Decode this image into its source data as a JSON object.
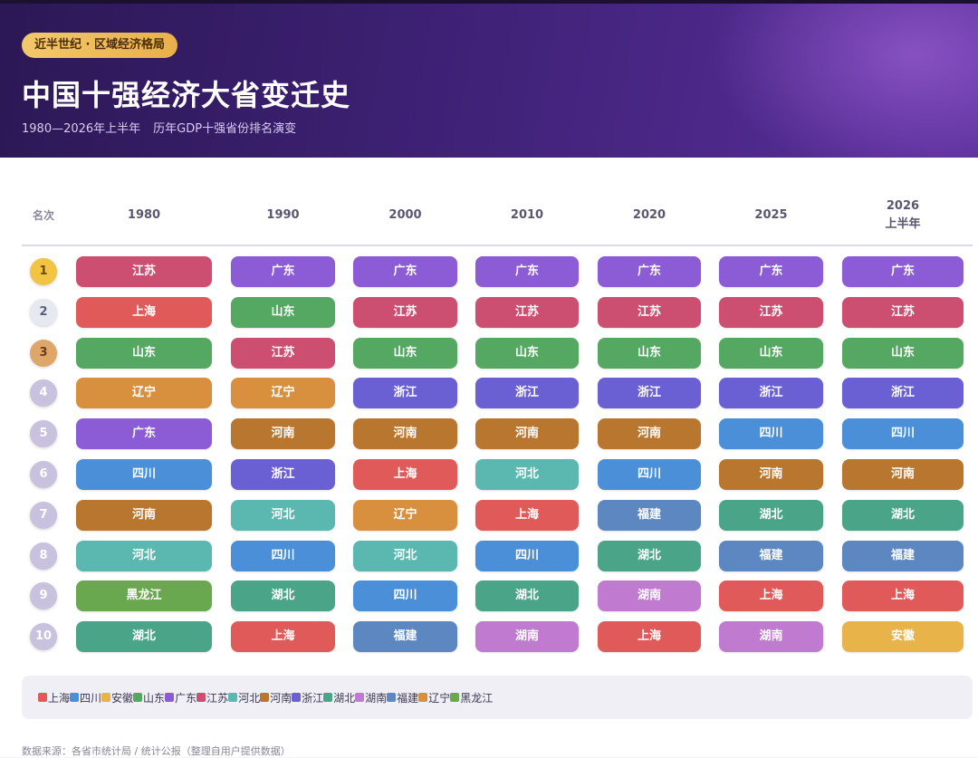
{
  "header": {
    "badge": "近半世纪 · 区域经济格局",
    "title": "中国十强经济大省变迁史",
    "subtitle_range": "1980—2026年上半年",
    "subtitle_desc": "历年GDP十强省份排名演变"
  },
  "table": {
    "rank_header": "名次",
    "columns": [
      {
        "label": "1980"
      },
      {
        "label": "1990"
      },
      {
        "label": "2000"
      },
      {
        "label": "2010"
      },
      {
        "label": "2020"
      },
      {
        "label": "2025"
      },
      {
        "label": "2026\n上半年"
      }
    ],
    "ranks": [
      "1",
      "2",
      "3",
      "4",
      "5",
      "6",
      "7",
      "8",
      "9",
      "10"
    ],
    "rankings": [
      [
        "江苏",
        "上海",
        "山东",
        "辽宁",
        "广东",
        "四川",
        "河南",
        "河北",
        "黑龙江",
        "湖北"
      ],
      [
        "广东",
        "山东",
        "江苏",
        "辽宁",
        "河南",
        "浙江",
        "河北",
        "四川",
        "湖北",
        "上海"
      ],
      [
        "广东",
        "江苏",
        "山东",
        "浙江",
        "河南",
        "上海",
        "辽宁",
        "河北",
        "四川",
        "福建"
      ],
      [
        "广东",
        "江苏",
        "山东",
        "浙江",
        "河南",
        "河北",
        "上海",
        "四川",
        "湖北",
        "湖南"
      ],
      [
        "广东",
        "江苏",
        "山东",
        "浙江",
        "河南",
        "四川",
        "福建",
        "湖北",
        "湖南",
        "上海"
      ],
      [
        "广东",
        "江苏",
        "山东",
        "浙江",
        "四川",
        "河南",
        "湖北",
        "福建",
        "上海",
        "湖南"
      ],
      [
        "广东",
        "江苏",
        "山东",
        "浙江",
        "四川",
        "河南",
        "湖北",
        "福建",
        "上海",
        "安徽"
      ]
    ]
  },
  "rank_colors": {
    "1": {
      "bg": "#f2c443",
      "fg": "#6b4a07"
    },
    "2": {
      "bg": "#e7e9f0",
      "fg": "#5a6078"
    },
    "3": {
      "bg": "#dfa66a",
      "fg": "#6a3d12"
    },
    "default": {
      "bg": "#c9c2de",
      "fg": "#ffffff"
    }
  },
  "province_colors": {
    "上海": "#e05a5a",
    "四川": "#4a8fd8",
    "安徽": "#e8b44a",
    "山东": "#55a862",
    "广东": "#8c5bd6",
    "江苏": "#cc4f72",
    "河北": "#5ab8b0",
    "河南": "#b8762e",
    "浙江": "#6b5fd4",
    "湖北": "#4aa487",
    "湖南": "#c07bd0",
    "福建": "#5d87c0",
    "辽宁": "#d9903e",
    "黑龙江": "#6aa84f"
  },
  "legend": [
    "上海",
    "四川",
    "安徽",
    "山东",
    "广东",
    "江苏",
    "河北",
    "河南",
    "浙江",
    "湖北",
    "湖南",
    "福建",
    "辽宁",
    "黑龙江"
  ],
  "footnote": "数据来源：各省市统计局 / 统计公报（整理自用户提供数据）"
}
